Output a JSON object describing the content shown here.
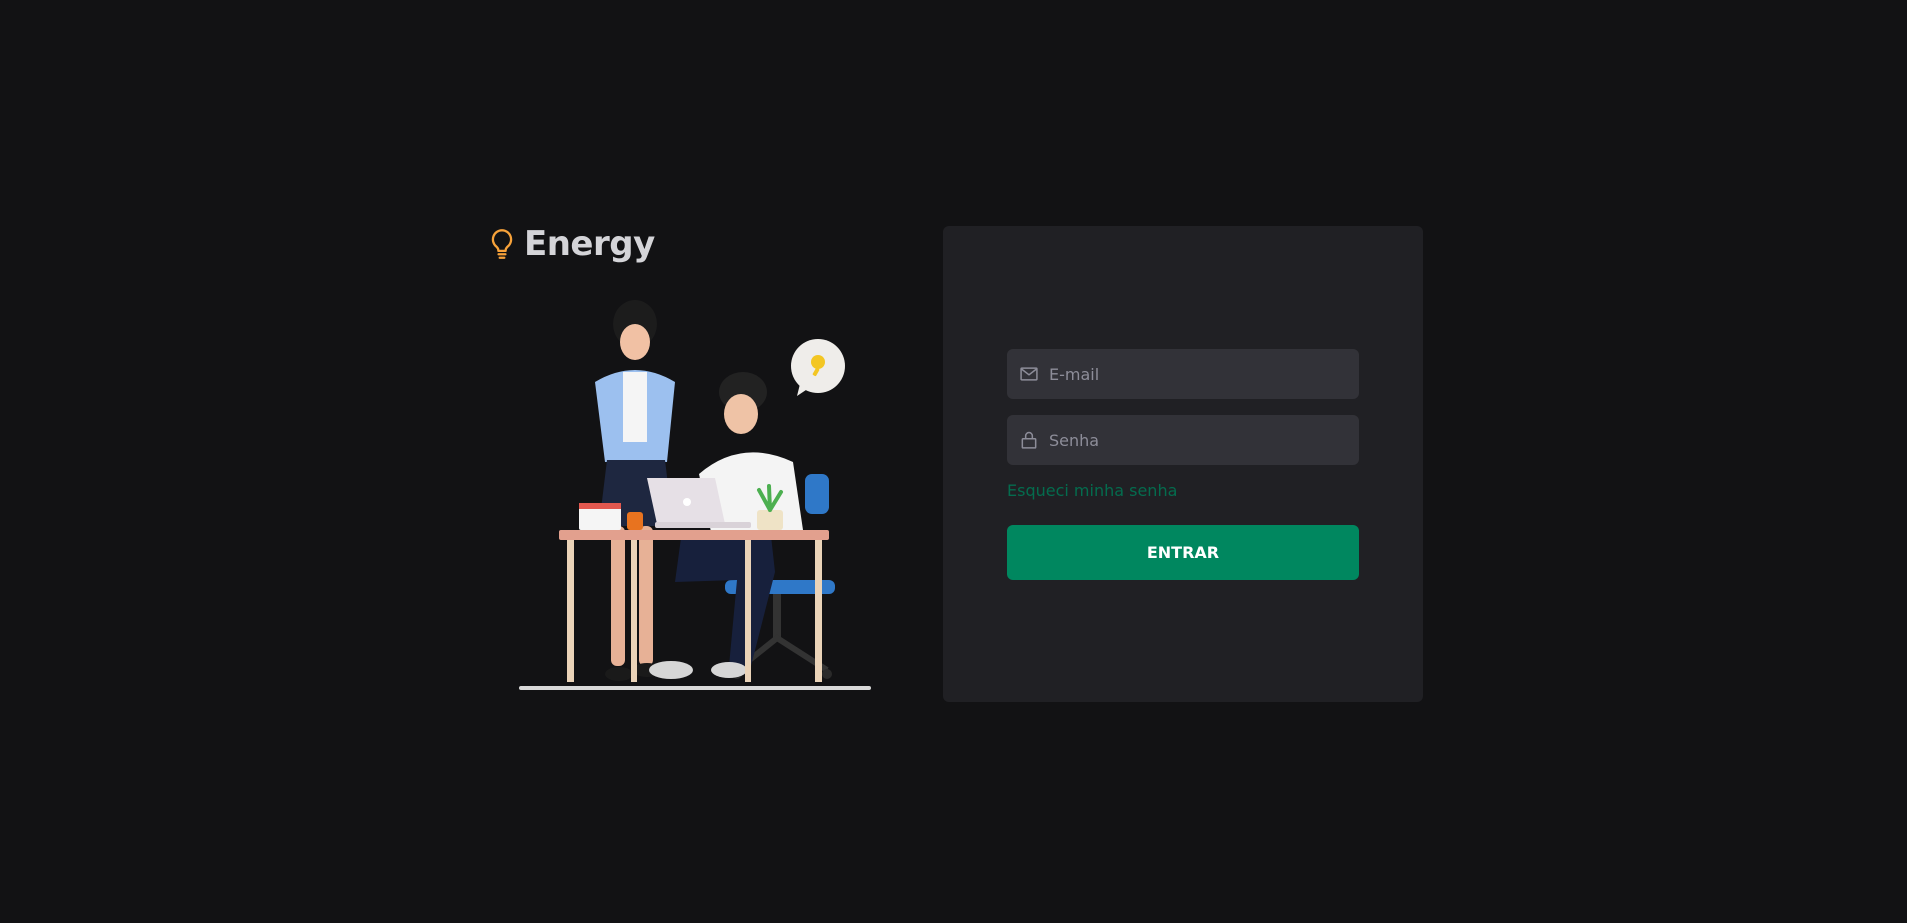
{
  "brand": {
    "name": "Energy",
    "icon": "lightbulb-icon",
    "icon_color": "#f7a23a"
  },
  "illustration": {
    "subject": "two people working at a desk with a laptop",
    "icon": "idea-bubble-icon"
  },
  "login": {
    "email": {
      "icon": "mail-icon",
      "placeholder": "E-mail",
      "value": ""
    },
    "password": {
      "icon": "lock-icon",
      "placeholder": "Senha",
      "value": ""
    },
    "forgot_label": "Esqueci minha senha",
    "submit_label": "ENTRAR"
  },
  "colors": {
    "background": "#121214",
    "card": "#202024",
    "input": "#323238",
    "accent": "#00875f",
    "link": "#046c4e"
  }
}
